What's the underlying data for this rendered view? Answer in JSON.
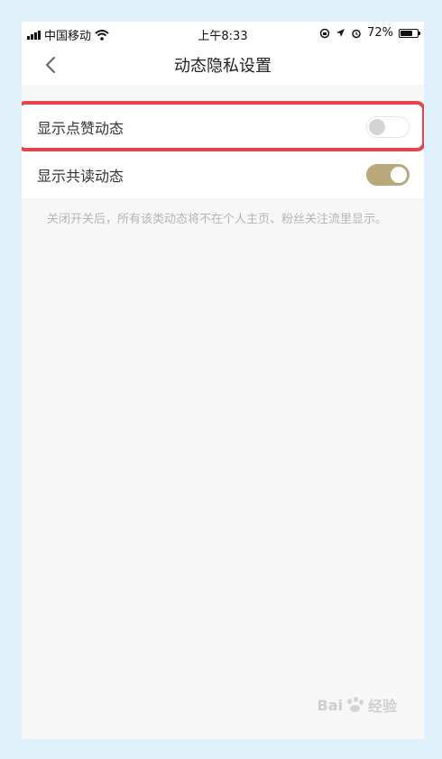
{
  "status_bar": {
    "carrier": "中国移动",
    "time": "上午8:33",
    "battery": "72%",
    "battery_level": 0.72
  },
  "nav": {
    "title": "动态隐私设置",
    "back_icon": "chevron-left-icon"
  },
  "settings": [
    {
      "label": "显示点赞动态",
      "enabled": false
    },
    {
      "label": "显示共读动态",
      "enabled": true
    }
  ],
  "hint": "关闭开关后，所有该类动态将不在个人主页、粉丝关注流里显示。",
  "watermark": {
    "text": "Bai",
    "suffix": "经验"
  },
  "colors": {
    "toggle_on": "#b9a87c",
    "highlight": "#e8454b",
    "frame": "#dff1fb"
  }
}
